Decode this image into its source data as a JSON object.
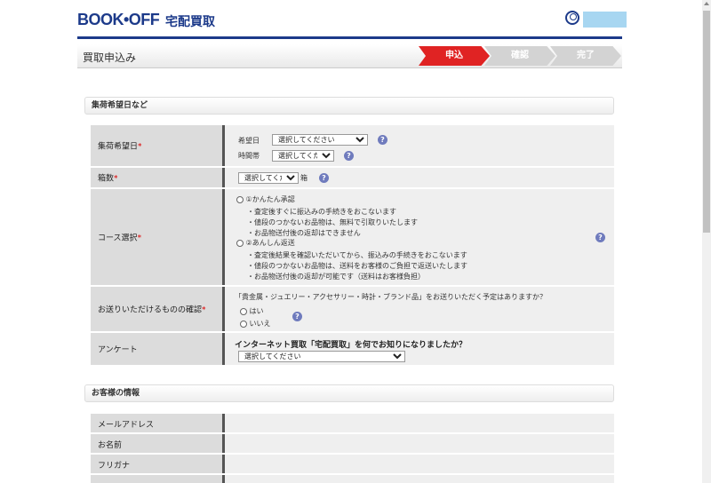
{
  "header": {
    "logo_text": "BOOK•OFF",
    "logo_sub": "宅配買取"
  },
  "titlebar": {
    "title": "買取申込み",
    "steps": [
      {
        "label": "申込",
        "active": true
      },
      {
        "label": "確認",
        "active": false
      },
      {
        "label": "完了",
        "active": false
      }
    ]
  },
  "sections": {
    "pickup": "集荷希望日など",
    "customer": "お客様の情報"
  },
  "form": {
    "pickup_date": {
      "label": "集荷希望日",
      "required_mark": "*",
      "date_label": "希望日",
      "date_value": "選択してください",
      "time_label": "時間帯",
      "time_value": "選択してください"
    },
    "boxes": {
      "label": "箱数",
      "required_mark": "*",
      "value": "選択してください",
      "unit": "箱"
    },
    "course": {
      "label": "コース選択",
      "required_mark": "*",
      "option1_title": "①かんたん承認",
      "option1_lines": [
        "・査定後すぐに振込みの手続きをおこないます",
        "・値段のつかないお品物は、無料で引取りいたします",
        "・お品物送付後の返却はできません"
      ],
      "option2_title": "②あんしん返送",
      "option2_lines": [
        "・査定後結果を確認いただいてから、振込みの手続きをおこないます",
        "・値段のつかないお品物は、送料をお客様のご負担で返送いたします",
        "・お品物送付後の返却が可能です（送料はお客様負担）"
      ]
    },
    "confirm": {
      "label": "お送りいただけるものの確認",
      "required_mark": "*",
      "question": "「貴金属・ジュエリー・アクセサリー・時計・ブランド品」をお送りいただく予定はありますか？",
      "yes": "はい",
      "no": "いいえ"
    },
    "survey": {
      "label": "アンケート",
      "question": "インターネット買取「宅配買取」を何でお知りになりましたか？",
      "value": "選択してください"
    }
  },
  "customer_rows": [
    {
      "label": "メールアドレス"
    },
    {
      "label": "お名前"
    },
    {
      "label": "フリガナ"
    },
    {
      "label": ""
    }
  ],
  "help_symbol": "?"
}
